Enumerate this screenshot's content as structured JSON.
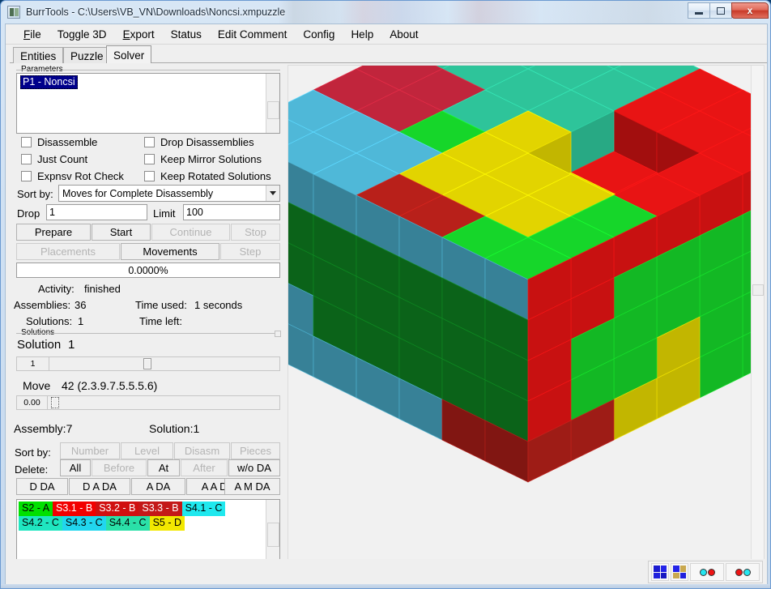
{
  "window": {
    "title": "BurrTools - C:\\Users\\VB_VN\\Downloads\\Noncsi.xmpuzzle",
    "app_icon": "burrtools-icon",
    "minimize_label": "Minimize",
    "maximize_label": "Maximize",
    "close_label": "x"
  },
  "menubar": {
    "items": [
      {
        "label": "File",
        "mnemonic": "F"
      },
      {
        "label": "Toggle 3D",
        "mnemonic": ""
      },
      {
        "label": "Export",
        "mnemonic": "E"
      },
      {
        "label": "Status",
        "mnemonic": ""
      },
      {
        "label": "Edit Comment",
        "mnemonic": ""
      },
      {
        "label": "Config",
        "mnemonic": ""
      },
      {
        "label": "Help",
        "mnemonic": ""
      },
      {
        "label": "About",
        "mnemonic": ""
      }
    ]
  },
  "tabs": [
    {
      "label": "Entities",
      "active": false
    },
    {
      "label": "Puzzle",
      "active": false
    },
    {
      "label": "Solver",
      "active": true
    }
  ],
  "solver": {
    "parameters_group_label": "Parameters",
    "parameter_list": [
      {
        "label": "P1 - Noncsi",
        "selected": true
      }
    ],
    "checkboxes": [
      {
        "label": "Disassemble",
        "checked": false
      },
      {
        "label": "Drop Disassemblies",
        "checked": false
      },
      {
        "label": "Just Count",
        "checked": false
      },
      {
        "label": "Keep Mirror Solutions",
        "checked": false
      },
      {
        "label": "Expnsv Rot Check",
        "checked": false
      },
      {
        "label": "Keep Rotated Solutions",
        "checked": false
      }
    ],
    "sort_by_label": "Sort by:",
    "sort_by_value": "Moves for Complete Disassembly",
    "drop_label": "Drop",
    "drop_value": "1",
    "limit_label": "Limit",
    "limit_value": "100",
    "action_buttons": [
      {
        "label": "Prepare",
        "enabled": true
      },
      {
        "label": "Start",
        "enabled": true
      },
      {
        "label": "Continue",
        "enabled": false
      },
      {
        "label": "Stop",
        "enabled": false
      }
    ],
    "view_buttons": [
      {
        "label": "Placements",
        "enabled": false
      },
      {
        "label": "Movements",
        "enabled": true
      },
      {
        "label": "Step",
        "enabled": false
      }
    ],
    "progress_text": "0.0000%",
    "activity_label": "Activity:",
    "activity_value": "finished",
    "assemblies_label": "Assemblies:",
    "assemblies_value": "36",
    "time_used_label": "Time used:",
    "time_used_value": "1 seconds",
    "solutions_label": "Solutions:",
    "solutions_value": "1",
    "time_left_label": "Time left:",
    "time_left_value": ""
  },
  "solutions": {
    "group_label": "Solutions",
    "solution_heading_label": "Solution",
    "solution_heading_value": "1",
    "solution_slider_value": "1",
    "move_label": "Move",
    "move_value": "42 (2.3.9.7.5.5.5.6)",
    "move_slider_value": "0.00",
    "assembly_label": "Assembly:7",
    "solution_label": "Solution:1",
    "sort_by_label": "Sort by:",
    "sort_buttons": [
      {
        "label": "Number",
        "enabled": false
      },
      {
        "label": "Level",
        "enabled": false
      },
      {
        "label": "Disasm",
        "enabled": false
      },
      {
        "label": "Pieces",
        "enabled": false
      }
    ],
    "delete_label": "Delete:",
    "delete_buttons": [
      {
        "label": "All",
        "enabled": true
      },
      {
        "label": "Before",
        "enabled": false
      },
      {
        "label": "At",
        "enabled": true
      },
      {
        "label": "After",
        "enabled": false
      },
      {
        "label": "w/o DA",
        "enabled": true
      }
    ],
    "da_buttons": [
      {
        "label": "D DA",
        "enabled": true
      },
      {
        "label": "D A DA",
        "enabled": true
      },
      {
        "label": "A DA",
        "enabled": true
      },
      {
        "label": "A A DA",
        "enabled": true
      },
      {
        "label": "A M DA",
        "enabled": true
      }
    ],
    "pieces": [
      {
        "label": "S2 - A",
        "bg": "#00e000",
        "fg": "#000000"
      },
      {
        "label": "S3.1 - B",
        "bg": "#f20000",
        "fg": "#ffffff"
      },
      {
        "label": "S3.2 - B",
        "bg": "#d01010",
        "fg": "#ffffff"
      },
      {
        "label": "S3.3 - B",
        "bg": "#c41818",
        "fg": "#ffffff"
      },
      {
        "label": "S4.1 - C",
        "bg": "#1fe8ee",
        "fg": "#000000"
      },
      {
        "label": "S4.2 - C",
        "bg": "#1fe6c0",
        "fg": "#000000"
      },
      {
        "label": "S4.3 - C",
        "bg": "#21d6ee",
        "fg": "#000000"
      },
      {
        "label": "S4.4 - C",
        "bg": "#2ae0a8",
        "fg": "#000000"
      },
      {
        "label": "S5 - D",
        "bg": "#f2e800",
        "fg": "#000000"
      }
    ]
  },
  "view3d": {
    "name": "puzzle-3d-view",
    "background": "#f1f1f1",
    "grid": {
      "cols": 7,
      "rows": 7,
      "levels": 5
    },
    "piece_colors": {
      "teal": "#2ec49a",
      "crimson": "#c1253c",
      "lightblue": "#4fb8d8",
      "darkgreen": "#0f8e23",
      "brightgreen": "#16d62a",
      "red": "#e81414",
      "darkred": "#b8201a",
      "yellow": "#e2d400",
      "cyan": "#23c9c9"
    }
  },
  "statusbar": {
    "tools": [
      {
        "name": "view-mode-normal-icon",
        "type": "quad",
        "colors": [
          "#1a1ad0",
          "#2222e8",
          "#2020dd",
          "#1818c2"
        ]
      },
      {
        "name": "view-mode-shadow-icon",
        "type": "quad",
        "colors": [
          "#2222e8",
          "#c9a84e",
          "#c9a84e",
          "#2020dd"
        ]
      },
      {
        "name": "marker-toggle-1-icon",
        "type": "dots",
        "colors": [
          "#25e6f0",
          "#ee1414"
        ]
      },
      {
        "name": "marker-toggle-2-icon",
        "type": "dots",
        "colors": [
          "#ee1414",
          "#25e6f0"
        ]
      }
    ]
  }
}
